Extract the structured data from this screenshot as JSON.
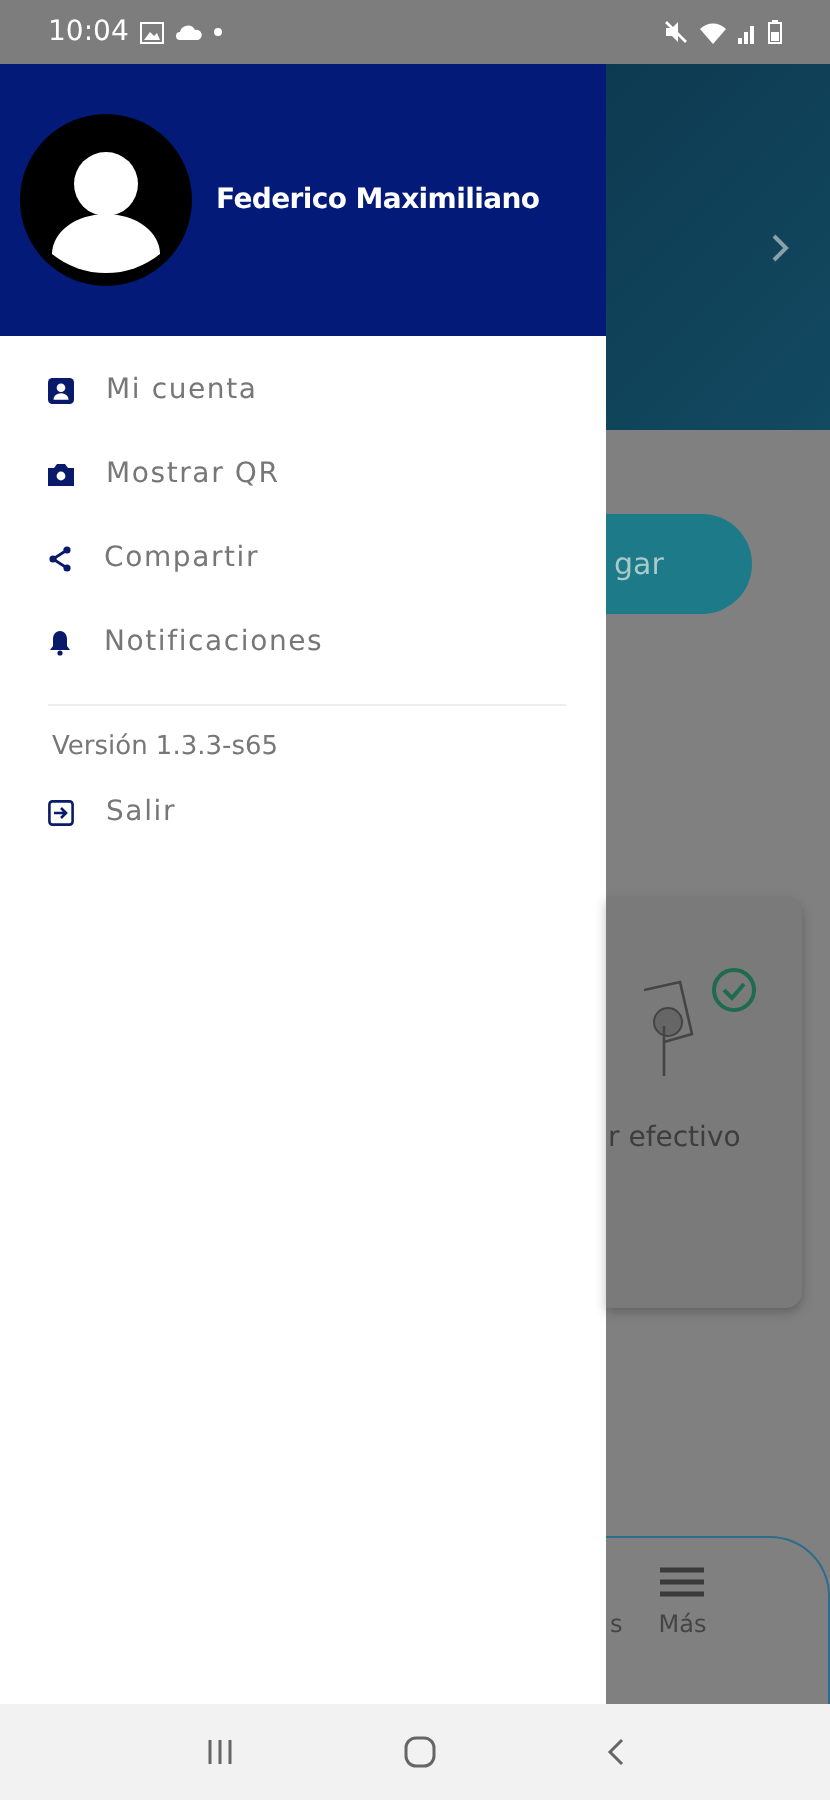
{
  "status_bar": {
    "time": "10:04"
  },
  "drawer": {
    "user_name": "Federico Maximiliano",
    "menu": [
      {
        "kind": "account",
        "label": "Mi cuenta"
      },
      {
        "kind": "camera",
        "label": "Mostrar QR"
      },
      {
        "kind": "share",
        "label": "Compartir"
      },
      {
        "kind": "bell",
        "label": "Notificaciones"
      }
    ],
    "version": "Versión 1.3.3-s65",
    "footer_menu": [
      {
        "kind": "exit",
        "label": "Salir"
      }
    ]
  },
  "background": {
    "pay_button": "gar",
    "card_label": "r efectivo",
    "bottom_nav": [
      {
        "label": "s"
      },
      {
        "label": "Más"
      }
    ]
  }
}
